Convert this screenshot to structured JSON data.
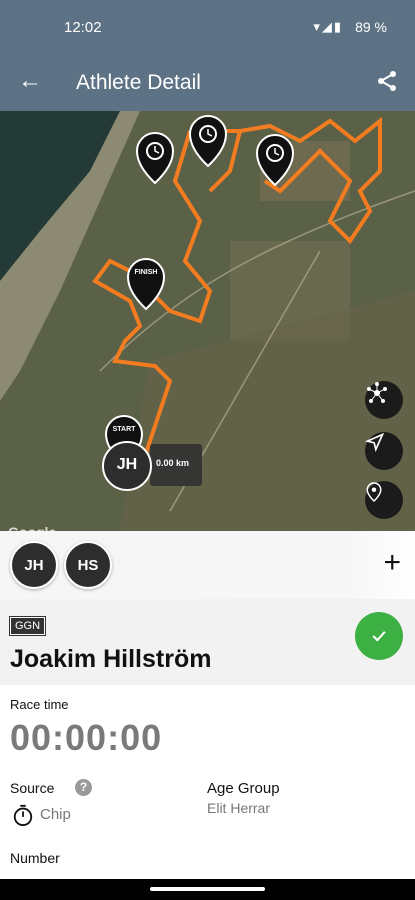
{
  "status": {
    "time": "12:02",
    "battery": "89 %",
    "icons": "▾◢▮"
  },
  "appbar": {
    "title": "Athlete Detail",
    "back_icon": "←"
  },
  "map": {
    "pins": {
      "finish": "FINISH",
      "start": "START"
    },
    "current_athlete": {
      "initials": "JH",
      "distance": "0.00 km"
    },
    "attribution": "Google",
    "route_color": "#f47c20"
  },
  "athletes": {
    "list": [
      "JH",
      "HS"
    ],
    "add_label": "+"
  },
  "athlete": {
    "team": "GGN",
    "name": "Joakim Hillström",
    "race_time_label": "Race time",
    "race_time": "00:00:00",
    "source_label": "Source",
    "source_value": "Chip",
    "age_group_label": "Age Group",
    "age_group_value": "Elit Herrar",
    "number_label": "Number",
    "status_color": "#3cb043"
  }
}
